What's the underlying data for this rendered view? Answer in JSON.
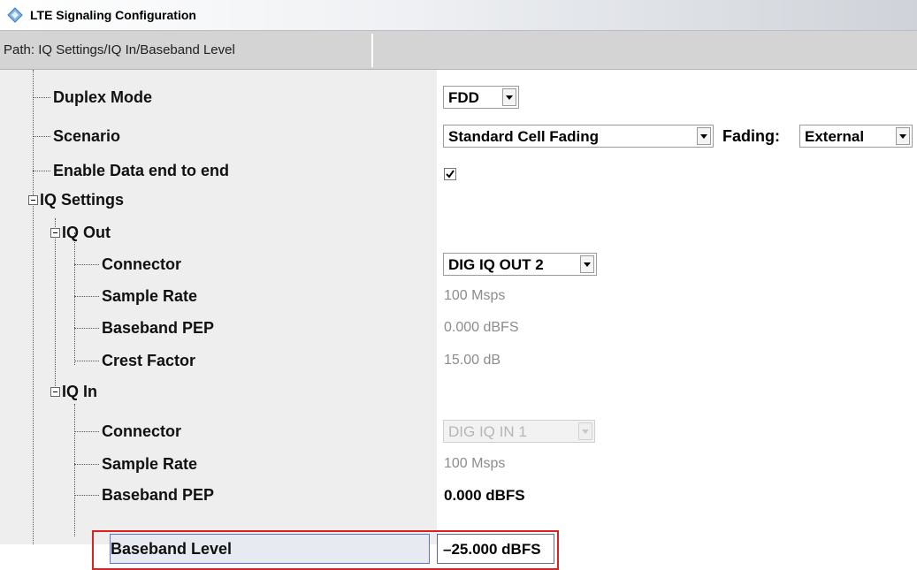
{
  "window": {
    "title": "LTE Signaling Configuration",
    "icon": "rs-logo-icon"
  },
  "path": {
    "text": "Path:  IQ Settings/IQ In/Baseband Level"
  },
  "tree": {
    "duplex_mode": {
      "label": "Duplex Mode",
      "value": "FDD"
    },
    "scenario": {
      "label": "Scenario",
      "value": "Standard Cell Fading",
      "fading_label": "Fading:",
      "fading_value": "External"
    },
    "enable_data": {
      "label": "Enable Data end to end",
      "checked": true
    },
    "iq_settings": {
      "label": "IQ Settings"
    },
    "iq_out": {
      "label": "IQ Out",
      "connector": {
        "label": "Connector",
        "value": "DIG IQ OUT 2"
      },
      "sample_rate": {
        "label": "Sample Rate",
        "value": "100 Msps"
      },
      "baseband_pep": {
        "label": "Baseband PEP",
        "value": "0.000  dBFS"
      },
      "crest_factor": {
        "label": "Crest Factor",
        "value": "15.00 dB"
      }
    },
    "iq_in": {
      "label": "IQ In",
      "connector": {
        "label": "Connector",
        "value": "DIG IQ IN 1"
      },
      "sample_rate": {
        "label": "Sample Rate",
        "value": "100 Msps"
      },
      "baseband_pep": {
        "label": "Baseband PEP",
        "value": "0.000  dBFS"
      },
      "baseband_level": {
        "label": "Baseband Level",
        "value": "–25.000 dBFS"
      }
    }
  },
  "colors": {
    "highlight": "#e02020",
    "selection_border": "#5d76c9",
    "left_panel": "#eeeeee"
  }
}
